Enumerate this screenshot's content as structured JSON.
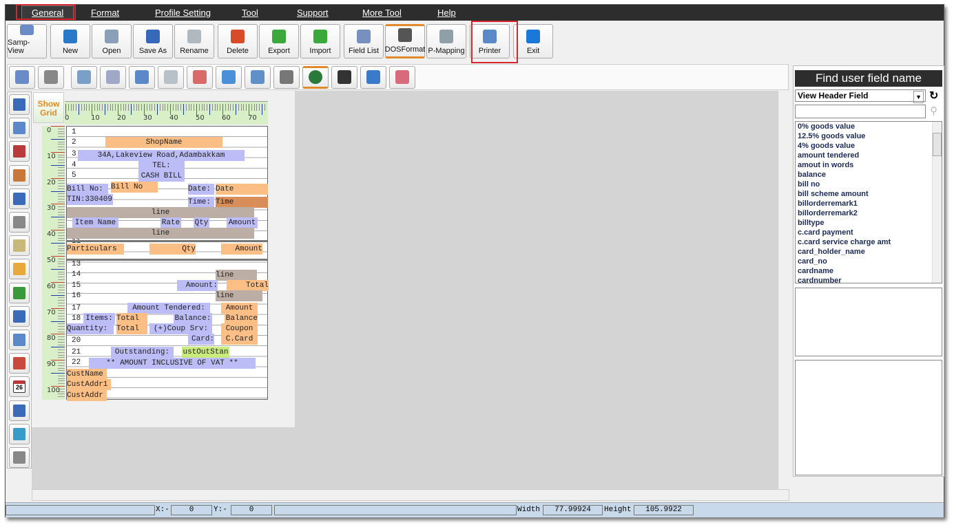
{
  "menu": [
    "General",
    "Format",
    "Profile Setting",
    "Tool",
    "Support",
    "More Tool",
    "Help"
  ],
  "toolbar": [
    {
      "label": "Samp-View",
      "icon": "sample-view-icon",
      "color": "#6a8ac8"
    },
    {
      "label": "New",
      "icon": "new-icon",
      "color": "#2a78c8"
    },
    {
      "label": "Open",
      "icon": "open-icon",
      "color": "#8aa0b8"
    },
    {
      "label": "Save As",
      "icon": "save-as-icon",
      "color": "#3868b8"
    },
    {
      "label": "Rename",
      "icon": "rename-icon",
      "color": "#b0b8c0"
    },
    {
      "label": "Delete",
      "icon": "delete-icon",
      "color": "#d84a2a"
    },
    {
      "label": "Export",
      "icon": "export-icon",
      "color": "#3aa83a"
    },
    {
      "label": "Import",
      "icon": "import-icon",
      "color": "#3aa83a"
    },
    {
      "label": "Field List",
      "icon": "field-list-icon",
      "color": "#7890c0"
    },
    {
      "label": "DOSFormat",
      "icon": "dos-format-icon",
      "color": "#555555"
    },
    {
      "label": "P-Mapping",
      "icon": "p-mapping-icon",
      "color": "#90a0a8"
    },
    {
      "label": "Printer",
      "icon": "printer-icon",
      "color": "#5a88c8"
    },
    {
      "label": "Exit",
      "icon": "exit-icon",
      "color": "#1a78d8"
    }
  ],
  "toolbar2": [
    "preview-icon",
    "print-icon",
    "edit-fields-icon",
    "field-settings-icon",
    "printer-settings-icon",
    "page-settings-icon",
    "align-icon",
    "cloud-upload-icon",
    "cloud-download-icon",
    "receipt-printer-icon",
    "globe-icon",
    "cash-drawer-icon",
    "network-printer-icon",
    "printer-alt-icon"
  ],
  "left_tools": [
    "text-tool-icon",
    "layout-icon",
    "pen-icon",
    "pencil-icon",
    "dots-icon",
    "page-icon",
    "notes-icon",
    "edit-icon",
    "image-icon",
    "numbered-list-icon",
    "list-icon",
    "clock-icon",
    "calendar-icon",
    "number-icon",
    "percent-icon",
    "coins-icon"
  ],
  "calendar_day": "26",
  "design": {
    "show_grid": "Show Grid",
    "ruler_top": [
      "0",
      "10",
      "20",
      "30",
      "40",
      "50",
      "60",
      "70"
    ],
    "ruler_left": [
      "0",
      "10",
      "20",
      "30",
      "40",
      "50",
      "60",
      "70",
      "80",
      "90",
      "100"
    ],
    "row_numbers": [
      "1",
      "2",
      "3",
      "4",
      "5",
      "11",
      "13",
      "14",
      "15",
      "16",
      "17",
      "18",
      "20",
      "21",
      "22"
    ],
    "fields": [
      "ShopName",
      "34A,Lakeview Road,Adambakkam",
      "TEL:",
      "CASH BILL",
      "Bill No:",
      "Bill No",
      "Date:",
      "Date",
      "TIN:330409",
      "Time:",
      "Time",
      "line",
      "Item Name",
      "Rate",
      "Qty",
      "Amount",
      "line",
      "Particulars",
      "Qty",
      "Amount",
      "line",
      "Amount:",
      "Total",
      "line",
      "Amount Tendered:",
      "Amount",
      "Items:",
      "Total",
      "Balance:",
      "Balance",
      "Quantity:",
      "Total",
      "(+)Coup Srv:",
      "Coupon",
      "Card:",
      "C.Card",
      "Outstanding:",
      "ustOutStan",
      "**  AMOUNT INCLUSIVE OF VAT  **",
      "CustName",
      "CustAddr1",
      "CustAddr"
    ]
  },
  "colors": {
    "orange": "#fbbf86",
    "lavender": "#bcbcf7",
    "gray": "#bcaea4",
    "dark_orange": "#d98e5a",
    "green": "#c9ea7c"
  },
  "right_panel": {
    "title": "Find user field name",
    "dropdown": "View Header Field",
    "search_value": "",
    "fields": [
      "0% goods value",
      "12.5% goods value",
      "4% goods value",
      "amount tendered",
      "amout in words",
      "balance",
      "bill no",
      "bill scheme amount",
      "billorderremark1",
      "billorderremark2",
      "billtype",
      "c.card payment",
      "c.card service charge amt",
      "card_holder_name",
      "card_no",
      "cardname",
      "cardnumber"
    ]
  },
  "status": {
    "x_label": "X:-",
    "x": "0",
    "y_label": "Y:-",
    "y": "0",
    "width_label": "Width",
    "width": "77.99924",
    "height_label": "Height",
    "height": "105.9922"
  }
}
